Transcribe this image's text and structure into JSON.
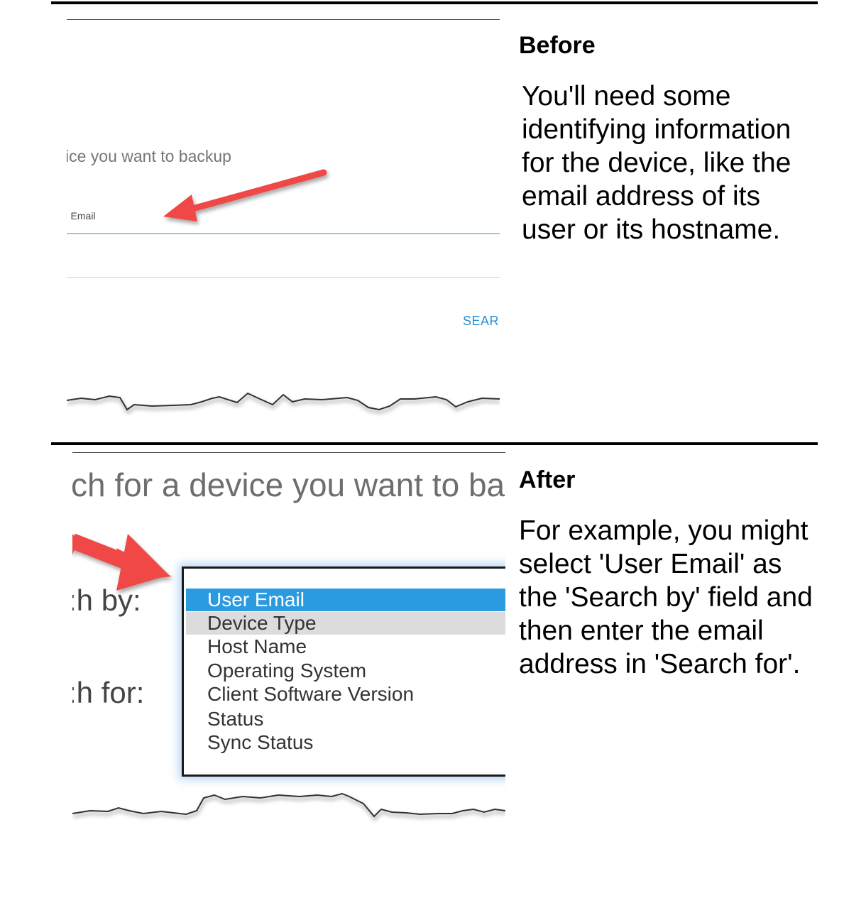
{
  "before": {
    "title": "Before",
    "body": "You'll need some identifying information for the device, like the email address of its user or its hostname.",
    "screenshot": {
      "heading": "ice you want to backup",
      "field_label": "· Email",
      "search_button": "SEARC"
    }
  },
  "after": {
    "title": "After",
    "body": "For example, you might select 'User Email' as the 'Search by' field and then enter the email address in 'Search for'.",
    "screenshot": {
      "heading": "ch for a device you want to bac",
      "search_by_label": ":h by:",
      "search_for_label": ":h for:",
      "options": [
        "User Email",
        "Device Type",
        "Host Name",
        "Operating System",
        "Client Software Version",
        "Status",
        "Sync Status"
      ],
      "selected_option": "User Email",
      "hovered_option": "Device Type"
    }
  },
  "colors": {
    "arrow": "#f04646",
    "selected": "#2b9be0",
    "hover": "#dcdcdc",
    "link": "#2a8fd6"
  }
}
